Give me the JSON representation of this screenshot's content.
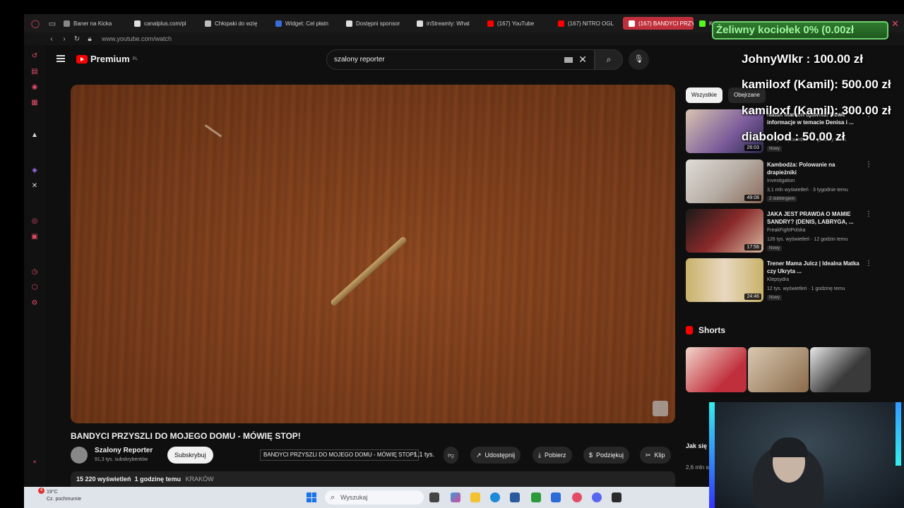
{
  "browser": {
    "tabs": [
      {
        "label": "Baner na Kicka",
        "color": "#888888"
      },
      {
        "label": "canalplus.com/pl",
        "color": "#dddddd"
      },
      {
        "label": "Chłopaki do wzię",
        "color": "#bbbbbb"
      },
      {
        "label": "Widget: Cel płatn",
        "color": "#3a6bd9"
      },
      {
        "label": "Dostępni sponsor",
        "color": "#dddddd"
      },
      {
        "label": "inStreamly: What",
        "color": "#dddddd"
      },
      {
        "label": "(167) YouTube",
        "color": "#ff0000"
      },
      {
        "label": "(167) NITRO OGL",
        "color": "#ff0000"
      },
      {
        "label": "(167) BANDYCI PRZY",
        "color": "#ff0000"
      },
      {
        "label": "K",
        "color": "#53fc18"
      }
    ],
    "url": "www.youtube.com/watch"
  },
  "youtube": {
    "logo": "Premium",
    "region": "PL",
    "search_value": "szalony reporter",
    "video_title": "BANDYCI PRZYSZLI DO MOJEGO DOMU - MÓWIĘ STOP!",
    "channel": {
      "name": "Szalony Reporter",
      "subs": "91,3 tys. subskrybentów",
      "subscribe": "Subskrybuj"
    },
    "tooltip": "BANDYCI PRZYSZLI DO MOJEGO DOMU - MÓWIĘ STOP!",
    "likes": "1,1 tys.",
    "actions": {
      "share": "Udostępnij",
      "download": "Pobierz",
      "thanks": "Podziękuj",
      "clip": "Klip"
    },
    "meta": {
      "views": "15 220 wyświetleń",
      "time": "1 godzinę temu",
      "location": "KRAKÓW"
    },
    "chips": [
      "Wszystkie",
      "Obejrzane"
    ],
    "recommendations": [
      {
        "title": "Natan Marcoń ujawnia! Nowe informacje w temacie Denisa i ...",
        "channel": "",
        "views": "6,2 tys. wyświetleń · 2 godziny temu",
        "badge": "Nowy",
        "duration": "26:03",
        "color": "#7a5a9a"
      },
      {
        "title": "Kambodża: Polowanie na drapieżniki",
        "channel": "Investigation",
        "views": "3,1 mln wyświetleń · 3 tygodnie temu",
        "badge": "Z dubbingiem",
        "duration": "49:08",
        "color": "#b8b0a8"
      },
      {
        "title": "JAKA JEST PRAWDA O MAMIE SANDRY? (DENIS, LABRYGA, ...",
        "channel": "FreakFightPolska",
        "views": "126 tys. wyświetleń · 12 godzin temu",
        "badge": "Nowy",
        "duration": "17:56",
        "color": "#8a2a2a"
      },
      {
        "title": "Trener Mama Julcz | Idealna Matka czy Ukryta ...",
        "channel": "Klepsydra",
        "views": "12 tys. wyświetleń · 1 godzinę temu",
        "badge": "Nowy",
        "duration": "24:46",
        "color": "#c9b26a"
      }
    ],
    "shorts_heading": "Shorts",
    "shorts_caption": "Jak się podryw...",
    "shorts_views": "2,6 mln wyświet..."
  },
  "overlay": {
    "goal": "Żeliwny kociołek 0% (0.00zł",
    "donations": [
      {
        "text": "JohnyWlkr : 100.00 zł"
      },
      {
        "text": "kamiloxf (Kamil): 500.00 zł"
      },
      {
        "text": "kamiloxf (Kamil): 300.00 zł"
      },
      {
        "text": "diabolod : 50.00 zł"
      }
    ]
  },
  "taskbar": {
    "weather_temp": "19°C",
    "weather_desc": "Cz. pochmurnie",
    "notification_count": "4",
    "search_placeholder": "Wyszukaj"
  }
}
